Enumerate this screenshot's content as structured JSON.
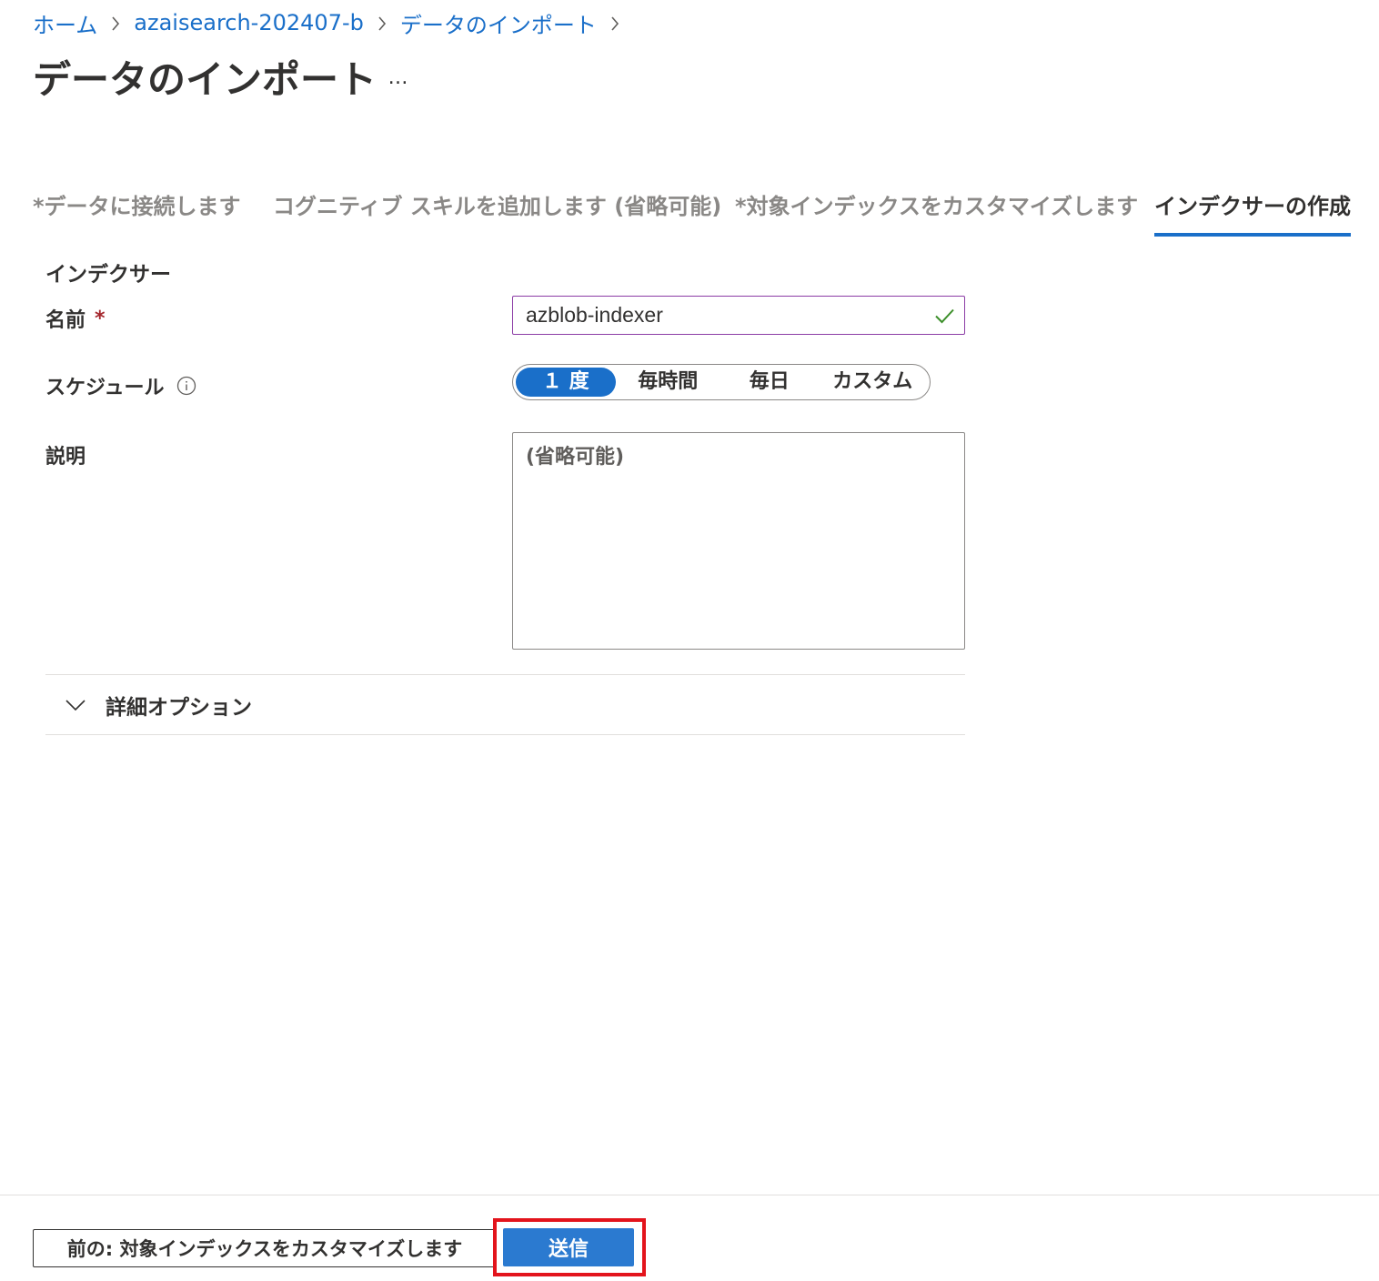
{
  "breadcrumb": {
    "items": [
      "ホーム",
      "azaisearch-202407-b",
      "データのインポート"
    ]
  },
  "page": {
    "title": "データのインポート",
    "more_label": "…"
  },
  "tabs": [
    {
      "label": "*データに接続します",
      "active": false
    },
    {
      "label": "コグニティブ スキルを追加します (省略可能)",
      "active": false
    },
    {
      "label": "*対象インデックスをカスタマイズします",
      "active": false
    },
    {
      "label": "インデクサーの作成",
      "active": true
    }
  ],
  "form": {
    "section_title": "インデクサー",
    "name": {
      "label": "名前",
      "required_mark": "*",
      "value": "azblob-indexer",
      "valid": true
    },
    "schedule": {
      "label": "スケジュール",
      "options": [
        "１ 度",
        "毎時間",
        "毎日",
        "カスタム"
      ],
      "selected": "１ 度"
    },
    "description": {
      "label": "説明",
      "placeholder": "(省略可能)"
    },
    "advanced": {
      "label": "詳細オプション",
      "expanded": false
    }
  },
  "footer": {
    "prev_label": "前の: 対象インデックスをカスタマイズします",
    "submit_label": "送信"
  },
  "colors": {
    "accent": "#1a6fc9",
    "primary_button": "#2b7ad0",
    "highlight_border": "#e3141c",
    "input_border_focus": "#8b3ca5",
    "valid_check": "#3c8f2a",
    "required": "#a4262c"
  },
  "icons": {
    "breadcrumb_separator": "chevron-right-icon",
    "name_valid": "checkmark-icon",
    "schedule_info": "info-icon",
    "advanced_toggle": "chevron-down-icon"
  }
}
